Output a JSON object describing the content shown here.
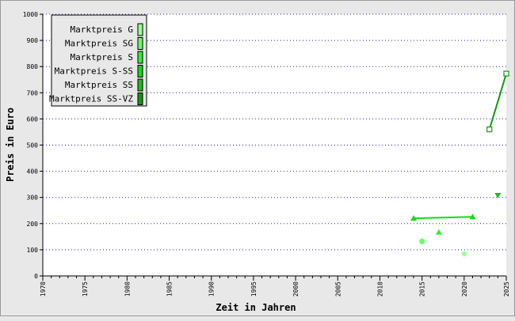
{
  "chart_data": {
    "type": "line",
    "xlabel": "Zeit in Jahren",
    "ylabel": "Preis in Euro",
    "xlim": [
      1970,
      2025
    ],
    "ylim": [
      0,
      1000
    ],
    "x_ticks": [
      "1970",
      "1975",
      "1980",
      "1985",
      "1990",
      "1995",
      "2000",
      "2005",
      "2010",
      "2015",
      "2020",
      "2025"
    ],
    "y_ticks": [
      "0",
      "100",
      "200",
      "300",
      "400",
      "500",
      "600",
      "700",
      "800",
      "900",
      "1000"
    ],
    "grid": "horizontal dotted",
    "legend_position": "top-left",
    "series": [
      {
        "name": "Marktpreis G",
        "color": "#99ff99",
        "marker": "diamond",
        "points": [
          {
            "x": 2020,
            "y": 85
          }
        ]
      },
      {
        "name": "Marktpreis SG",
        "color": "#66ff66",
        "marker": "circle",
        "points": [
          {
            "x": 2015,
            "y": 132
          }
        ]
      },
      {
        "name": "Marktpreis S",
        "color": "#33ee33",
        "marker": "triangle-up",
        "points": [
          {
            "x": 2017,
            "y": 167
          }
        ]
      },
      {
        "name": "Marktpreis S-SS",
        "color": "#11dd11",
        "marker": "triangle-up",
        "points": [
          {
            "x": 2014,
            "y": 220
          },
          {
            "x": 2021,
            "y": 226
          }
        ]
      },
      {
        "name": "Marktpreis SS",
        "color": "#22bb22",
        "marker": "triangle-down",
        "points": [
          {
            "x": 2024,
            "y": 308
          }
        ]
      },
      {
        "name": "Marktpreis SS-VZ",
        "color": "#119911",
        "marker": "square-open",
        "points": [
          {
            "x": 2023,
            "y": 560
          },
          {
            "x": 2025,
            "y": 773
          }
        ]
      }
    ]
  }
}
